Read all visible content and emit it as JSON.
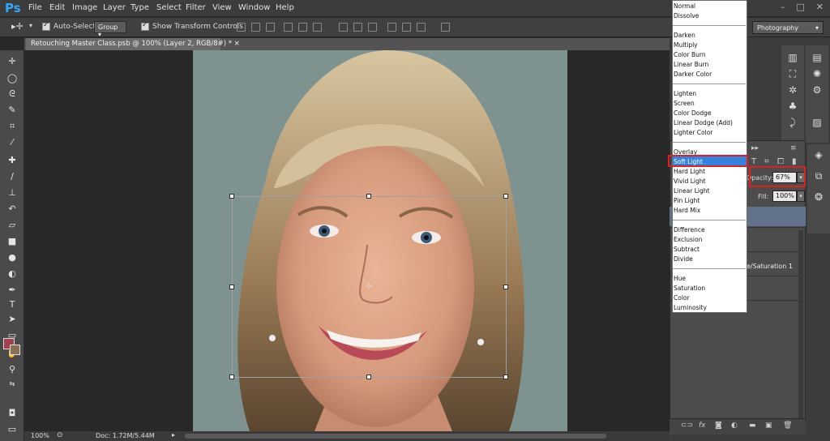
{
  "app": {
    "logo": "Ps"
  },
  "menu": [
    "File",
    "Edit",
    "Image",
    "Layer",
    "Type",
    "Select",
    "Filter",
    "View",
    "Window",
    "Help"
  ],
  "window_controls": [
    "–",
    "□",
    "✕"
  ],
  "options": {
    "auto_select_label": "Auto-Select:",
    "auto_select_value": "Group",
    "show_transform_label": "Show Transform Controls",
    "workspace": "Photography"
  },
  "document": {
    "tab_title": "Retouching Master Class.psb @ 100% (Layer 2, RGB/8#) *",
    "close_glyph": "×"
  },
  "status": {
    "zoom": "100%",
    "doc_info": "Doc: 1.72M/5.44M"
  },
  "layers_panel": {
    "opacity_label": "Opacity:",
    "opacity_value": "67%",
    "fill_label": "Fill:",
    "fill_value": "100%",
    "layer_partial_name": "e/Saturation 1"
  },
  "blend_modes": {
    "groups": [
      [
        "Normal",
        "Dissolve"
      ],
      [
        "Darken",
        "Multiply",
        "Color Burn",
        "Linear Burn",
        "Darker Color"
      ],
      [
        "Lighten",
        "Screen",
        "Color Dodge",
        "Linear Dodge (Add)",
        "Lighter Color"
      ],
      [
        "Overlay",
        "Soft Light",
        "Hard Light",
        "Vivid Light",
        "Linear Light",
        "Pin Light",
        "Hard Mix"
      ],
      [
        "Difference",
        "Exclusion",
        "Subtract",
        "Divide"
      ],
      [
        "Hue",
        "Saturation",
        "Color",
        "Luminosity"
      ]
    ],
    "selected": "Soft Light"
  },
  "colors": {
    "accent": "#31a8ff",
    "highlight": "#3284e0",
    "callout": "#e02020",
    "foreground": "#a04050",
    "background": "#8a7050"
  },
  "icons": {
    "tools": [
      "move-tool-icon",
      "marquee-tool-icon",
      "lasso-tool-icon",
      "quick-select-tool-icon",
      "crop-tool-icon",
      "eyedropper-tool-icon",
      "healing-brush-icon",
      "brush-tool-icon",
      "clone-stamp-icon",
      "history-brush-icon",
      "eraser-tool-icon",
      "gradient-tool-icon",
      "blur-tool-icon",
      "dodge-tool-icon",
      "pen-tool-icon",
      "type-tool-icon",
      "path-select-icon",
      "shape-tool-icon",
      "hand-tool-icon",
      "zoom-tool-icon"
    ]
  }
}
